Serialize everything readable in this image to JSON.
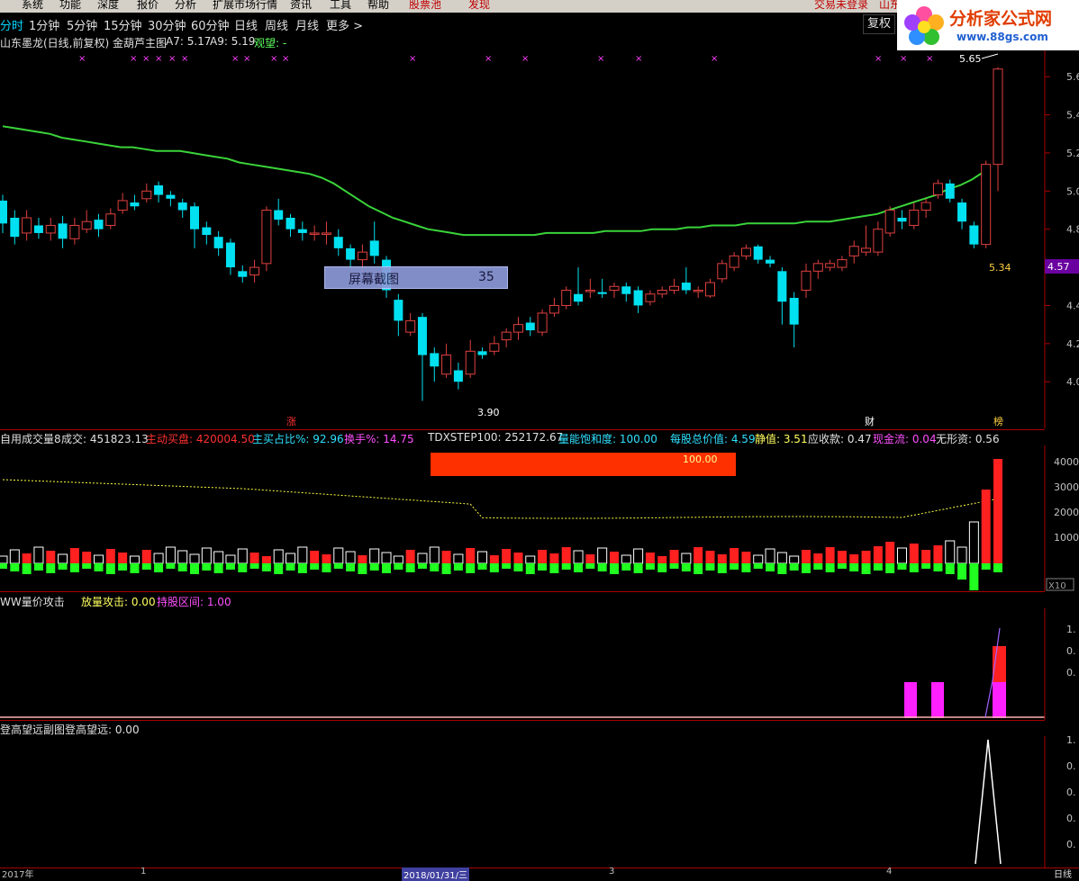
{
  "menu": {
    "items": [
      "系统",
      "功能",
      "深度",
      "报价",
      "分析",
      "扩展市场行情",
      "资讯",
      "工具",
      "帮助"
    ],
    "stock_pool": "股票池",
    "discover": "发现",
    "login_status": "交易未登录",
    "stock_short": "山东"
  },
  "periods": {
    "items": [
      "分时",
      "1分钟",
      "5分钟",
      "15分钟",
      "30分钟",
      "60分钟",
      "日线",
      "周线",
      "月线",
      "更多 >"
    ],
    "active": "分时",
    "restore_button": "复权"
  },
  "logo": {
    "line1": "分析家公式网",
    "line2": "www.88gs.com"
  },
  "main_chart": {
    "title": "山东墨龙(日线,前复权) 金葫芦主图",
    "a7_label": "A7: 5.17",
    "a9_label": "A9: 5.19",
    "watch_label": "观望: -",
    "high_label": "5.65",
    "low_label": "3.90",
    "close_marker": "5.34",
    "current_price": "4.57",
    "axis_labels": [
      "5.6",
      "5.4",
      "5.2",
      "5.0",
      "4.8",
      "4.6",
      "4.4",
      "4.2",
      "4.0"
    ],
    "event_markers": [
      "涨",
      "财",
      "榜"
    ],
    "colors": {
      "ma_line": "#3ad43a",
      "up": "#e04040",
      "down": "#00e0f0",
      "marker": "#ff40ff"
    }
  },
  "screenshot_overlay": {
    "label": "屏幕截图",
    "value": "35"
  },
  "volume_panel": {
    "title": "自用成交量8",
    "volume_label": "成交: 451823.13",
    "active_buy_label": "主动买盘: 420004.50",
    "main_buy_ratio_label": "主买占比%: 92.96",
    "turnover_label": "换手%: 14.75",
    "tdx_label": "TDXSTEP100: 252172.67",
    "energy_label": "量能饱和度: 100.00",
    "net_asset_label": "每股总价值: 4.59",
    "static_label": "静值: 3.51",
    "receivable_label": "应收款: 0.47",
    "cash_label": "现金流: 0.04",
    "intangible_label": "无形资: 0.56",
    "bar_value": "100.00",
    "axis_labels": [
      "4000",
      "3000",
      "2000",
      "1000"
    ],
    "unit": "X10"
  },
  "attack_panel": {
    "title": "WW量价攻击",
    "attack_label": "放量攻击: 0.00",
    "hold_label": "持股区间: 1.00",
    "axis_labels": [
      "1.",
      "0.",
      "0."
    ]
  },
  "climb_panel": {
    "title": "登高望远副图",
    "value_label": "登高望远: 0.00",
    "axis_labels": [
      "1.",
      "0.",
      "0.",
      "0.",
      "0."
    ]
  },
  "date_axis": {
    "labels": [
      "2017年",
      "1",
      "2018/01/31/三",
      "3",
      "4"
    ],
    "bottom_right": "日线"
  },
  "chart_data": {
    "type": "candlestick",
    "title": "山东墨龙(日线,前复权) 金葫芦主图",
    "ylim": [
      3.85,
      5.7
    ],
    "candles": [
      [
        4.95,
        4.83,
        4.98,
        4.78
      ],
      [
        4.86,
        4.76,
        4.9,
        4.72
      ],
      [
        4.78,
        4.86,
        4.9,
        4.74
      ],
      [
        4.82,
        4.78,
        4.86,
        4.75
      ],
      [
        4.78,
        4.82,
        4.86,
        4.74
      ],
      [
        4.83,
        4.75,
        4.87,
        4.7
      ],
      [
        4.75,
        4.82,
        4.86,
        4.72
      ],
      [
        4.8,
        4.84,
        4.9,
        4.78
      ],
      [
        4.85,
        4.8,
        4.88,
        4.76
      ],
      [
        4.82,
        4.88,
        4.91,
        4.8
      ],
      [
        4.9,
        4.95,
        4.99,
        4.88
      ],
      [
        4.94,
        4.92,
        4.98,
        4.9
      ],
      [
        4.96,
        5.0,
        5.04,
        4.94
      ],
      [
        5.03,
        4.98,
        5.05,
        4.94
      ],
      [
        4.98,
        4.96,
        5.0,
        4.92
      ],
      [
        4.94,
        4.9,
        4.96,
        4.86
      ],
      [
        4.92,
        4.8,
        4.94,
        4.7
      ],
      [
        4.81,
        4.77,
        4.84,
        4.72
      ],
      [
        4.76,
        4.7,
        4.79,
        4.66
      ],
      [
        4.73,
        4.6,
        4.75,
        4.56
      ],
      [
        4.58,
        4.55,
        4.61,
        4.52
      ],
      [
        4.56,
        4.6,
        4.64,
        4.52
      ],
      [
        4.62,
        4.9,
        4.92,
        4.58
      ],
      [
        4.9,
        4.85,
        4.96,
        4.82
      ],
      [
        4.86,
        4.8,
        4.88,
        4.76
      ],
      [
        4.8,
        4.78,
        4.84,
        4.74
      ],
      [
        4.78,
        4.78,
        4.82,
        4.74
      ],
      [
        4.78,
        4.78,
        4.84,
        4.72
      ],
      [
        4.76,
        4.7,
        4.8,
        4.66
      ],
      [
        4.7,
        4.64,
        4.72,
        4.6
      ],
      [
        4.64,
        4.68,
        4.72,
        4.58
      ],
      [
        4.74,
        4.66,
        4.84,
        4.62
      ],
      [
        4.64,
        4.48,
        4.66,
        4.44
      ],
      [
        4.43,
        4.32,
        4.46,
        4.24
      ],
      [
        4.26,
        4.32,
        4.36,
        4.24
      ],
      [
        4.34,
        4.14,
        4.36,
        3.9
      ],
      [
        4.15,
        4.08,
        4.18,
        4.0
      ],
      [
        4.04,
        4.14,
        4.2,
        4.02
      ],
      [
        4.06,
        4.0,
        4.1,
        3.96
      ],
      [
        4.04,
        4.16,
        4.22,
        4.02
      ],
      [
        4.16,
        4.14,
        4.18,
        4.12
      ],
      [
        4.16,
        4.2,
        4.24,
        4.14
      ],
      [
        4.22,
        4.26,
        4.28,
        4.18
      ],
      [
        4.26,
        4.3,
        4.34,
        4.22
      ],
      [
        4.31,
        4.27,
        4.34,
        4.24
      ],
      [
        4.26,
        4.36,
        4.38,
        4.24
      ],
      [
        4.36,
        4.4,
        4.44,
        4.34
      ],
      [
        4.4,
        4.48,
        4.5,
        4.38
      ],
      [
        4.46,
        4.42,
        4.6,
        4.4
      ],
      [
        4.48,
        4.48,
        4.54,
        4.44
      ],
      [
        4.47,
        4.46,
        4.54,
        4.44
      ],
      [
        4.48,
        4.5,
        4.52,
        4.44
      ],
      [
        4.5,
        4.46,
        4.52,
        4.42
      ],
      [
        4.48,
        4.4,
        4.5,
        4.36
      ],
      [
        4.42,
        4.46,
        4.48,
        4.4
      ],
      [
        4.46,
        4.48,
        4.5,
        4.44
      ],
      [
        4.48,
        4.5,
        4.54,
        4.46
      ],
      [
        4.52,
        4.48,
        4.6,
        4.46
      ],
      [
        4.48,
        4.48,
        4.5,
        4.44
      ],
      [
        4.45,
        4.52,
        4.54,
        4.44
      ],
      [
        4.54,
        4.62,
        4.64,
        4.52
      ],
      [
        4.6,
        4.66,
        4.68,
        4.58
      ],
      [
        4.66,
        4.7,
        4.72,
        4.64
      ],
      [
        4.71,
        4.64,
        4.72,
        4.62
      ],
      [
        4.64,
        4.62,
        4.66,
        4.6
      ],
      [
        4.58,
        4.42,
        4.6,
        4.3
      ],
      [
        4.44,
        4.3,
        4.47,
        4.18
      ],
      [
        4.48,
        4.58,
        4.62,
        4.44
      ],
      [
        4.58,
        4.62,
        4.64,
        4.54
      ],
      [
        4.6,
        4.62,
        4.64,
        4.58
      ],
      [
        4.6,
        4.64,
        4.66,
        4.58
      ],
      [
        4.66,
        4.71,
        4.74,
        4.62
      ],
      [
        4.68,
        4.7,
        4.82,
        4.66
      ],
      [
        4.68,
        4.8,
        4.84,
        4.66
      ],
      [
        4.78,
        4.9,
        4.92,
        4.76
      ],
      [
        4.86,
        4.84,
        4.9,
        4.8
      ],
      [
        4.82,
        4.9,
        4.94,
        4.8
      ],
      [
        4.9,
        4.94,
        4.96,
        4.86
      ],
      [
        4.98,
        5.04,
        5.06,
        4.96
      ],
      [
        5.04,
        4.96,
        5.06,
        4.94
      ],
      [
        4.94,
        4.84,
        4.96,
        4.8
      ],
      [
        4.82,
        4.72,
        4.84,
        4.7
      ],
      [
        4.72,
        5.14,
        5.16,
        4.7
      ],
      [
        5.14,
        5.64,
        5.65,
        5.0
      ]
    ],
    "ma_line": [
      5.34,
      5.33,
      5.32,
      5.31,
      5.3,
      5.28,
      5.27,
      5.26,
      5.25,
      5.24,
      5.23,
      5.23,
      5.22,
      5.21,
      5.21,
      5.21,
      5.2,
      5.19,
      5.18,
      5.17,
      5.15,
      5.14,
      5.13,
      5.12,
      5.11,
      5.1,
      5.09,
      5.07,
      5.04,
      5.0,
      4.96,
      4.92,
      4.89,
      4.86,
      4.84,
      4.82,
      4.8,
      4.79,
      4.78,
      4.77,
      4.77,
      4.77,
      4.77,
      4.77,
      4.77,
      4.77,
      4.78,
      4.78,
      4.78,
      4.78,
      4.78,
      4.79,
      4.79,
      4.79,
      4.79,
      4.8,
      4.8,
      4.8,
      4.81,
      4.81,
      4.82,
      4.82,
      4.82,
      4.83,
      4.83,
      4.83,
      4.83,
      4.83,
      4.84,
      4.84,
      4.84,
      4.85,
      4.86,
      4.87,
      4.88,
      4.9,
      4.92,
      4.94,
      4.96,
      4.98,
      5.01,
      5.03,
      5.06,
      5.1
    ]
  }
}
